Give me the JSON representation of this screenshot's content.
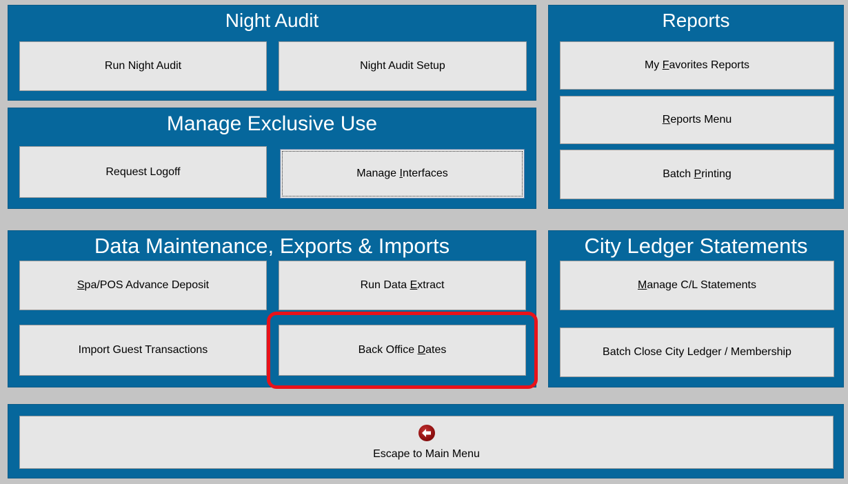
{
  "night_audit": {
    "title": "Night Audit",
    "run_night_audit": "Run Night Audit",
    "night_audit_setup": "Night Audit Setup"
  },
  "reports": {
    "title": "Reports",
    "my_favorites": {
      "pre": "My ",
      "u": "F",
      "post": "avorites Reports"
    },
    "reports_menu": {
      "pre": "",
      "u": "R",
      "post": "eports Menu"
    },
    "batch_printing": {
      "pre": "Batch ",
      "u": "P",
      "post": "rinting"
    }
  },
  "exclusive_use": {
    "title": "Manage Exclusive Use",
    "request_logoff": "Request Logoff",
    "manage_interfaces": {
      "pre": "Manage ",
      "u": "I",
      "post": "nterfaces"
    }
  },
  "data_maintenance": {
    "title": "Data Maintenance, Exports & Imports",
    "spa_pos": {
      "pre": "",
      "u": "S",
      "post": "pa/POS Advance Deposit"
    },
    "run_data_extract": {
      "pre": "Run Data ",
      "u": "E",
      "post": "xtract"
    },
    "import_guest": "Import Guest Transactions",
    "back_office_dates": {
      "pre": "Back Office ",
      "u": "D",
      "post": "ates"
    }
  },
  "city_ledger": {
    "title": "City Ledger Statements",
    "manage_cl": {
      "pre": "",
      "u": "M",
      "post": "anage C/L Statements"
    },
    "batch_close": "Batch Close City Ledger / Membership"
  },
  "escape": {
    "label": "Escape to Main Menu",
    "icon": "back-arrow-icon"
  },
  "colors": {
    "panel": "#06679c",
    "background": "#c4c4c4",
    "button": "#e6e6e6",
    "highlight": "#e8121a"
  }
}
